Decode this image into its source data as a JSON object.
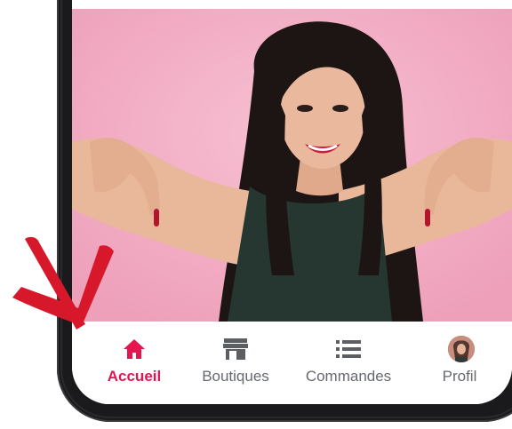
{
  "bottom_nav": {
    "items": [
      {
        "label": "Accueil",
        "icon": "home-icon",
        "active": true
      },
      {
        "label": "Boutiques",
        "icon": "store-icon",
        "active": false
      },
      {
        "label": "Commandes",
        "icon": "list-icon",
        "active": false
      },
      {
        "label": "Profil",
        "icon": "profile-avatar",
        "active": false
      }
    ]
  },
  "colors": {
    "accent": "#e3164f",
    "inactive": "#666a70",
    "hero_background": "#f2a6bf",
    "annotation_check": "#d7182a"
  }
}
